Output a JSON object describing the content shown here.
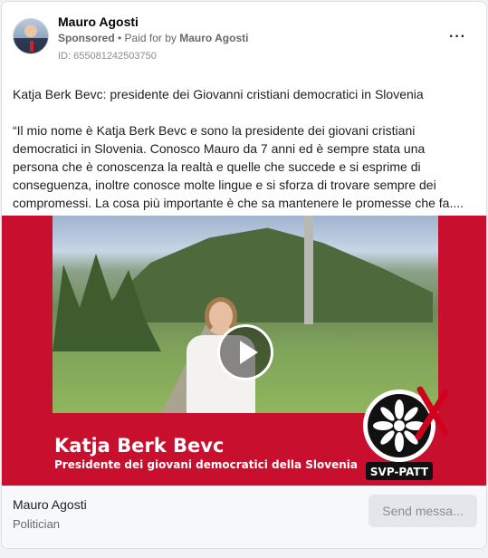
{
  "post": {
    "page_name": "Mauro Agosti",
    "sponsored_label": "Sponsored",
    "paid_prefix": " • Paid for by ",
    "paid_by": "Mauro Agosti",
    "ad_id": "ID: 655081242503750",
    "more_icon": "···",
    "headline": "Katja Berk Bevc: presidente dei Giovanni cristiani democratici in Slovenia",
    "body": "“Il mio nome è Katja Berk Bevc e sono la presidente dei giovani cristiani democratici in Slovenia. Conosco Mauro da 7 anni ed è sempre stata una persona che è conoscenza la realtà e quelle che succede e si esprime di conseguenza, inoltre conosce molte lingue e si sforza di trovare sempre dei compromessi. La cosa più importante è che sa mantenere le promesse che fa...."
  },
  "video": {
    "caption_name": "Katja Berk Bevc",
    "caption_subtitle": "Presidente dei giovani democratici della Slovenia",
    "logo_text": "SVP-PATT",
    "brand_color": "#c8102e"
  },
  "footer": {
    "page_name": "Mauro Agosti",
    "category": "Politician",
    "send_button": "Send messa..."
  },
  "colors": {
    "card_bg": "#ffffff",
    "page_bg": "#f0f2f5",
    "secondary_text": "#65676b",
    "button_disabled_bg": "#e4e6eb"
  }
}
